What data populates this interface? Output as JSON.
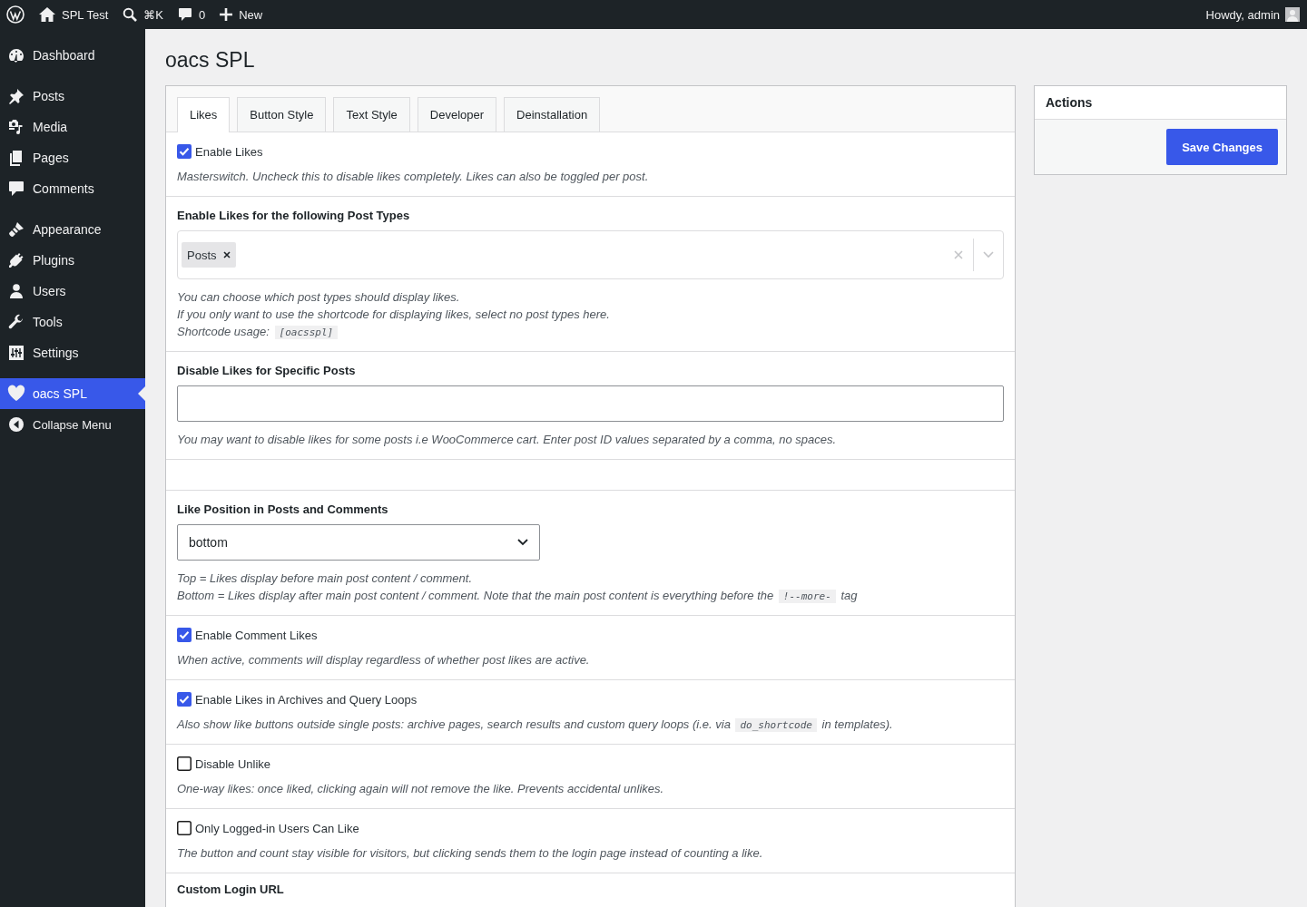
{
  "admin_bar": {
    "items": [
      {
        "kind": "logo"
      },
      {
        "kind": "home",
        "label": "SPL Test"
      },
      {
        "kind": "search",
        "label": "⌘K"
      },
      {
        "kind": "comments",
        "label": "0"
      },
      {
        "kind": "new",
        "label": "New"
      }
    ],
    "greeting": "Howdy, admin"
  },
  "sidebar": {
    "groups": [
      [
        {
          "label": "Dashboard",
          "selected": false
        }
      ],
      [
        {
          "label": "Posts",
          "selected": false
        },
        {
          "label": "Media",
          "selected": false
        },
        {
          "label": "Pages",
          "selected": false
        },
        {
          "label": "Comments",
          "selected": false
        }
      ],
      [
        {
          "label": "Appearance",
          "selected": false
        },
        {
          "label": "Plugins",
          "selected": false
        },
        {
          "label": "Users",
          "selected": false
        },
        {
          "label": "Tools",
          "selected": false
        },
        {
          "label": "Settings",
          "selected": false
        }
      ],
      [
        {
          "label": "oacs SPL",
          "selected": true
        }
      ]
    ],
    "collapse": "Collapse Menu"
  },
  "page_title": "oacs SPL",
  "tabs": [
    {
      "label": "Likes",
      "selected": true
    },
    {
      "label": "Button Style",
      "selected": false
    },
    {
      "label": "Text Style",
      "selected": false
    },
    {
      "label": "Developer",
      "selected": false
    },
    {
      "label": "Deinstallation",
      "selected": false
    }
  ],
  "sections": [
    {
      "kind": "checkbox",
      "label": "Enable Likes",
      "checked": true,
      "help": [
        [
          {
            "kind": "text",
            "text": "Masterswitch. Uncheck this to disable likes completely. Likes can also be toggled per post."
          }
        ]
      ]
    },
    {
      "kind": "multiselect",
      "title": "Enable Likes for the following Post Types",
      "chips": [
        "Posts"
      ],
      "help": [
        [
          {
            "kind": "text",
            "text": "You can choose which post types should display likes."
          }
        ],
        [
          {
            "kind": "text",
            "text": "If you only want to use the shortcode for displaying likes, select no post types here."
          }
        ],
        [
          {
            "kind": "text",
            "text": "Shortcode usage: "
          },
          {
            "kind": "code",
            "text": "[oacsspl]"
          }
        ]
      ]
    },
    {
      "kind": "text_input",
      "title": "Disable Likes for Specific Posts",
      "help": [
        [
          {
            "kind": "text",
            "text": "You may want to disable likes for some posts i.e WooCommerce cart. Enter post ID values separated by a comma, no spaces."
          }
        ]
      ]
    },
    {
      "kind": "spacer"
    },
    {
      "kind": "select",
      "title": "Like Position in Posts and Comments",
      "value": "bottom",
      "help": [
        [
          {
            "kind": "text",
            "text": "Top = Likes display before main post content / comment."
          }
        ],
        [
          {
            "kind": "text",
            "text": "Bottom = Likes display after main post content / comment. Note that the main post content is everything before the "
          },
          {
            "kind": "code",
            "text": "!--more-"
          },
          {
            "kind": "text",
            "text": " tag"
          }
        ]
      ]
    },
    {
      "kind": "checkbox",
      "label": "Enable Comment Likes",
      "checked": true,
      "help": [
        [
          {
            "kind": "text",
            "text": "When active, comments will display regardless of whether post likes are active."
          }
        ]
      ]
    },
    {
      "kind": "checkbox",
      "label": "Enable Likes in Archives and Query Loops",
      "checked": true,
      "help": [
        [
          {
            "kind": "text",
            "text": "Also show like buttons outside single posts: archive pages, search results and custom query loops (i.e. via "
          },
          {
            "kind": "code",
            "text": "do_shortcode"
          },
          {
            "kind": "text",
            "text": " in templates)."
          }
        ]
      ]
    },
    {
      "kind": "checkbox",
      "label": "Disable Unlike",
      "checked": false,
      "help": [
        [
          {
            "kind": "text",
            "text": "One-way likes: once liked, clicking again will not remove the like. Prevents accidental unlikes."
          }
        ]
      ]
    },
    {
      "kind": "checkbox",
      "label": "Only Logged-in Users Can Like",
      "checked": false,
      "help": [
        [
          {
            "kind": "text",
            "text": "The button and count stay visible for visitors, but clicking sends them to the login page instead of counting a like."
          }
        ]
      ]
    },
    {
      "kind": "heading",
      "title": "Custom Login URL"
    }
  ],
  "actions": {
    "title": "Actions",
    "button": "Save Changes"
  }
}
